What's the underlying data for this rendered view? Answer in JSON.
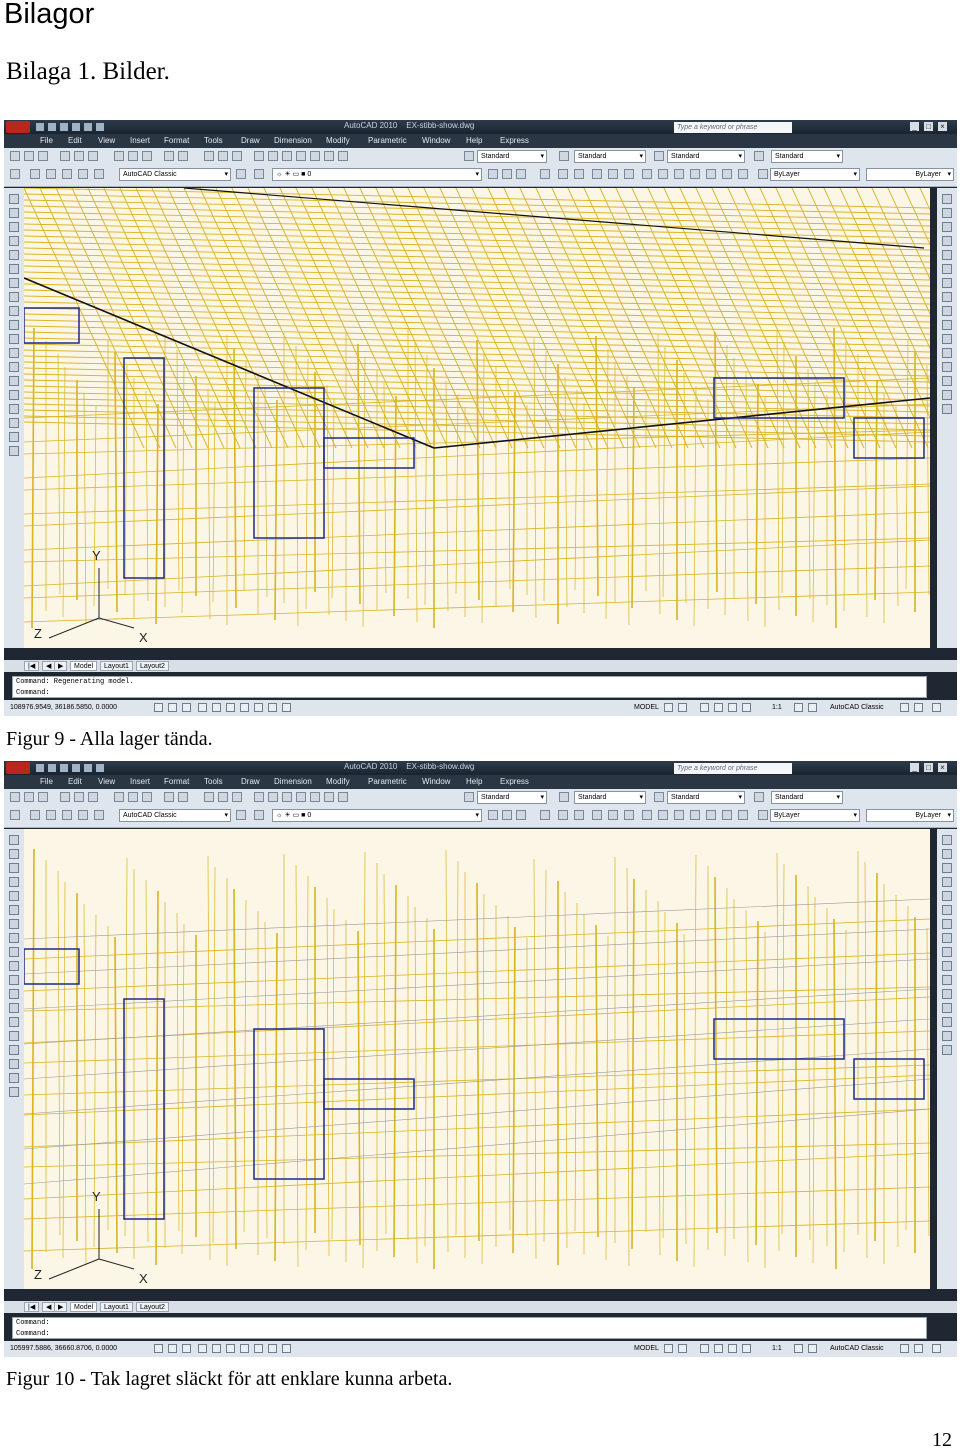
{
  "page": {
    "heading": "Bilagor",
    "subheading": "Bilaga 1. Bilder.",
    "page_number": "12"
  },
  "figures": [
    {
      "caption": "Figur 9 - Alla lager tända.",
      "window_title": "AutoCAD 2010    EX-stibb-show.dwg",
      "search_placeholder": "Type a keyword or phrase",
      "menu": [
        "File",
        "Edit",
        "View",
        "Insert",
        "Format",
        "Tools",
        "Draw",
        "Dimension",
        "Modify",
        "Parametric",
        "Window",
        "Help",
        "Express"
      ],
      "text_style": "Standard",
      "dim_style": "Standard",
      "table_style": "Standard",
      "mleader_style": "Standard",
      "workspace": "AutoCAD Classic",
      "layer": "0",
      "color": "ByLayer",
      "linetype": "ByLayer",
      "tabs": [
        "Model",
        "Layout1",
        "Layout2"
      ],
      "command_lines": [
        "Command:  Regenerating model.",
        "Command:"
      ],
      "coordinates": "108976.9549, 36186.5850, 0.0000",
      "status_model": "MODEL",
      "scale": "1:1",
      "status_workspace": "AutoCAD Classic",
      "ucs": {
        "y": "Y",
        "x": "X",
        "z": "Z"
      },
      "roof_visible": true
    },
    {
      "caption": "Figur 10 - Tak lagret släckt för att enklare kunna arbeta.",
      "window_title": "AutoCAD 2010    EX-stibb-show.dwg",
      "search_placeholder": "Type a keyword or phrase",
      "menu": [
        "File",
        "Edit",
        "View",
        "Insert",
        "Format",
        "Tools",
        "Draw",
        "Dimension",
        "Modify",
        "Parametric",
        "Window",
        "Help",
        "Express"
      ],
      "text_style": "Standard",
      "dim_style": "Standard",
      "table_style": "Standard",
      "mleader_style": "Standard",
      "workspace": "AutoCAD Classic",
      "layer": "0",
      "color": "ByLayer",
      "linetype": "ByLayer",
      "tabs": [
        "Model",
        "Layout1",
        "Layout2"
      ],
      "command_lines": [
        "Command:",
        "Command:"
      ],
      "coordinates": "105997.5886, 36660.8706, 0.0000",
      "status_model": "MODEL",
      "scale": "1:1",
      "status_workspace": "AutoCAD Classic",
      "ucs": {
        "y": "Y",
        "x": "X",
        "z": "Z"
      },
      "roof_visible": false
    }
  ],
  "colors": {
    "canvas_bg": "#fbf6e6",
    "frame_yellow": "#d8b423",
    "frame_blue": "#1c2a8c",
    "window_chrome": "#1e2732"
  }
}
